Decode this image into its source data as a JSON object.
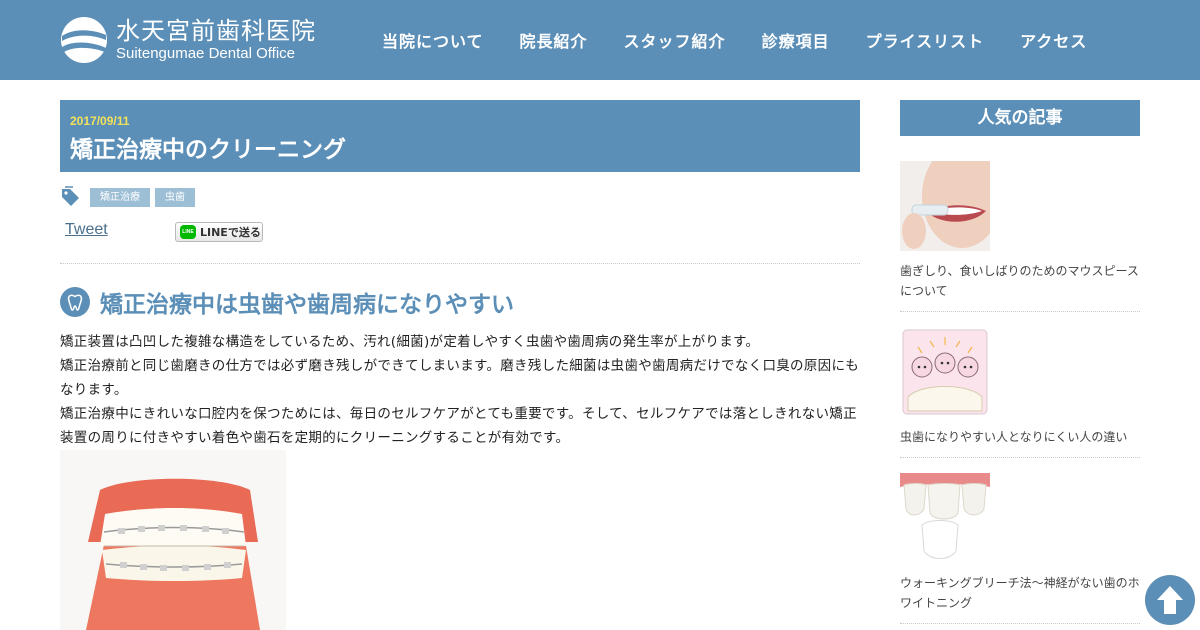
{
  "header": {
    "logo_ja": "水天宮前歯科医院",
    "logo_en": "Suitengumae Dental Office",
    "nav": [
      "当院について",
      "院長紹介",
      "スタッフ紹介",
      "診療項目",
      "プライスリスト",
      "アクセス"
    ]
  },
  "article": {
    "date": "2017/09/11",
    "title": "矯正治療中のクリーニング",
    "tags": [
      "矯正治療",
      "虫歯"
    ],
    "tweet_label": "Tweet",
    "line_button": {
      "badge": "LINE",
      "label": "LINEで送る"
    },
    "section_heading": "矯正治療中は虫歯や歯周病になりやすい",
    "paragraphs": [
      "矯正装置は凸凹した複雑な構造をしているため、汚れ(細菌)が定着しやすく虫歯や歯周病の発生率が上がります。",
      "矯正治療前と同じ歯磨きの仕方では必ず磨き残しができてしまいます。磨き残した細菌は虫歯や歯周病だけでなく口臭の原因にもなります。",
      "矯正治療中にきれいな口腔内を保つためには、毎日のセルフケアがとても重要です。そして、セルフケアでは落としきれない矯正装置の周りに付きやすい着色や歯石を定期的にクリーニングすることが有効です。"
    ]
  },
  "sidebar": {
    "title": "人気の記事",
    "items": [
      {
        "label": "歯ぎしり、食いしばりのためのマウスピースについて"
      },
      {
        "label": "虫歯になりやすい人となりにくい人の違い"
      },
      {
        "label": "ウォーキングブリーチ法～神経がない歯のホワイトニング"
      }
    ]
  },
  "colors": {
    "brand": "#5c8fb7",
    "tag": "#9cbfd6",
    "date": "#f2e25a"
  },
  "icons": {
    "tag": "tag-icon",
    "tooth": "tooth-icon",
    "scroll_top": "arrow-up-icon"
  }
}
